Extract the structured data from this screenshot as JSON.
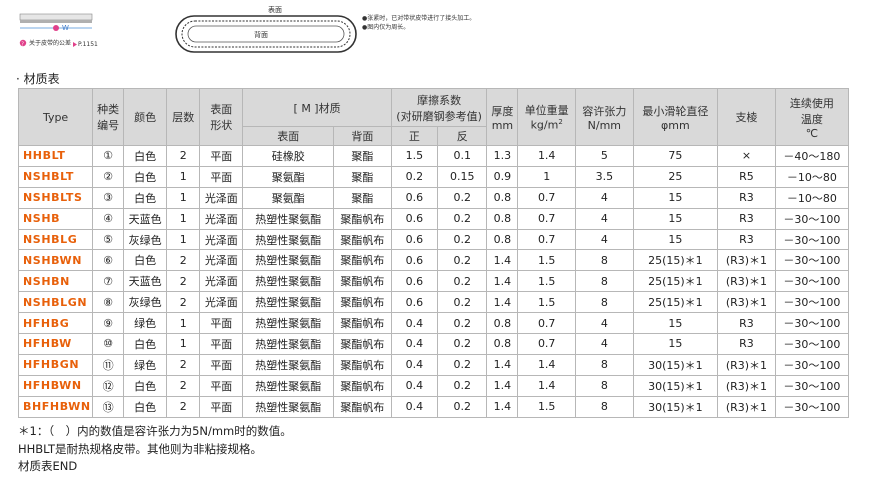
{
  "figure": {
    "w_label": "W",
    "ref_text": "关于皮带的公差",
    "ref_page": "P.1151",
    "surface_label": "表面",
    "back_label": "背面",
    "notes": [
      "●张紧时，已对带状皮带进行了接头加工。",
      "●图内仅为周长。"
    ]
  },
  "section_title": "· 材质表",
  "table": {
    "headers": {
      "type": "Type",
      "kind_no": [
        "种类",
        "编号"
      ],
      "color": "颜色",
      "layers": "层数",
      "surface_shape": [
        "表面",
        "形状"
      ],
      "material": "[ M ]材质",
      "material_surface": "表面",
      "material_back": "背面",
      "friction": [
        "摩擦系数",
        "(对研磨钢参考值)"
      ],
      "friction_front": "正",
      "friction_back": "反",
      "thickness": [
        "厚度",
        "mm"
      ],
      "unit_weight": "单位重量",
      "unit_weight_unit": "kg/m",
      "unit_weight_sup": "2",
      "tension": [
        "容许张力",
        "N/mm"
      ],
      "pulley": [
        "最小滑轮直径",
        "φmm"
      ],
      "support": "支棱",
      "temp": [
        "连续使用",
        "温度",
        "℃"
      ]
    },
    "rows": [
      [
        "HHBLT",
        "①",
        "白色",
        "2",
        "平面",
        "硅橡胶",
        "聚酯",
        "1.5",
        "0.1",
        "1.3",
        "1.4",
        "5",
        "75",
        "×",
        "－40～180"
      ],
      [
        "NSHBLT",
        "②",
        "白色",
        "1",
        "平面",
        "聚氨酯",
        "聚酯",
        "0.2",
        "0.15",
        "0.9",
        "1",
        "3.5",
        "25",
        "R5",
        "－10～80"
      ],
      [
        "NSHBLTS",
        "③",
        "白色",
        "1",
        "光泽面",
        "聚氨酯",
        "聚酯",
        "0.6",
        "0.2",
        "0.8",
        "0.7",
        "4",
        "15",
        "R3",
        "－10～80"
      ],
      [
        "NSHB",
        "④",
        "天蓝色",
        "1",
        "光泽面",
        "热塑性聚氨酯",
        "聚酯帆布",
        "0.6",
        "0.2",
        "0.8",
        "0.7",
        "4",
        "15",
        "R3",
        "－30～100"
      ],
      [
        "NSHBLG",
        "⑤",
        "灰绿色",
        "1",
        "光泽面",
        "热塑性聚氨酯",
        "聚酯帆布",
        "0.6",
        "0.2",
        "0.8",
        "0.7",
        "4",
        "15",
        "R3",
        "－30～100"
      ],
      [
        "NSHBWN",
        "⑥",
        "白色",
        "2",
        "光泽面",
        "热塑性聚氨酯",
        "聚酯帆布",
        "0.6",
        "0.2",
        "1.4",
        "1.5",
        "8",
        "25(15)＊1",
        "(R3)＊1",
        "－30～100"
      ],
      [
        "NSHBN",
        "⑦",
        "天蓝色",
        "2",
        "光泽面",
        "热塑性聚氨酯",
        "聚酯帆布",
        "0.6",
        "0.2",
        "1.4",
        "1.5",
        "8",
        "25(15)＊1",
        "(R3)＊1",
        "－30～100"
      ],
      [
        "NSHBLGN",
        "⑧",
        "灰绿色",
        "2",
        "光泽面",
        "热塑性聚氨酯",
        "聚酯帆布",
        "0.6",
        "0.2",
        "1.4",
        "1.5",
        "8",
        "25(15)＊1",
        "(R3)＊1",
        "－30～100"
      ],
      [
        "HFHBG",
        "⑨",
        "绿色",
        "1",
        "平面",
        "热塑性聚氨酯",
        "聚酯帆布",
        "0.4",
        "0.2",
        "0.8",
        "0.7",
        "4",
        "15",
        "R3",
        "－30～100"
      ],
      [
        "HFHBW",
        "⑩",
        "白色",
        "1",
        "平面",
        "热塑性聚氨酯",
        "聚酯帆布",
        "0.4",
        "0.2",
        "0.8",
        "0.7",
        "4",
        "15",
        "R3",
        "－30～100"
      ],
      [
        "HFHBGN",
        "⑪",
        "绿色",
        "2",
        "平面",
        "热塑性聚氨酯",
        "聚酯帆布",
        "0.4",
        "0.2",
        "1.4",
        "1.4",
        "8",
        "30(15)＊1",
        "(R3)＊1",
        "－30～100"
      ],
      [
        "HFHBWN",
        "⑫",
        "白色",
        "2",
        "平面",
        "热塑性聚氨酯",
        "聚酯帆布",
        "0.4",
        "0.2",
        "1.4",
        "1.4",
        "8",
        "30(15)＊1",
        "(R3)＊1",
        "－30～100"
      ],
      [
        "BHFHBWN",
        "⑬",
        "白色",
        "2",
        "平面",
        "热塑性聚氨酯",
        "聚酯帆布",
        "0.4",
        "0.2",
        "1.4",
        "1.5",
        "8",
        "30(15)＊1",
        "(R3)＊1",
        "－30～100"
      ]
    ]
  },
  "footnotes": [
    "＊1：（　）内的数值是容许张力为5N/mm时的数值。",
    "HHBLT是耐热规格皮带。其他则为非粘接规格。",
    "材质表END"
  ],
  "colors": {
    "type_text": "#e8600a",
    "header_bg": "#d9d9d9",
    "border": "#b7b7b7",
    "accent_pink": "#e0408a"
  }
}
